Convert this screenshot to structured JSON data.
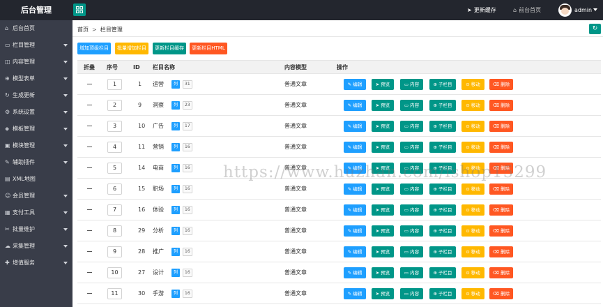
{
  "header": {
    "logo": "后台管理",
    "clear_cache": "更新缓存",
    "front_home": "前台首页",
    "admin": "admin"
  },
  "sidebar": {
    "items": [
      {
        "label": "后台首页",
        "icon": "home-icon",
        "caret": false
      },
      {
        "label": "栏目管理",
        "icon": "monitor-icon",
        "caret": true
      },
      {
        "label": "内容管理",
        "icon": "layers-icon",
        "caret": true
      },
      {
        "label": "模型表单",
        "icon": "globe-icon",
        "caret": true
      },
      {
        "label": "生成更新",
        "icon": "refresh-icon",
        "caret": true
      },
      {
        "label": "系统设置",
        "icon": "gear-icon",
        "caret": true
      },
      {
        "label": "模板管理",
        "icon": "template-icon",
        "caret": true
      },
      {
        "label": "模块管理",
        "icon": "module-icon",
        "caret": true
      },
      {
        "label": "辅助插件",
        "icon": "plugin-icon",
        "caret": true
      },
      {
        "label": "XML地图",
        "icon": "map-icon",
        "caret": false
      },
      {
        "label": "会员管理",
        "icon": "user-icon",
        "caret": true
      },
      {
        "label": "支付工具",
        "icon": "wallet-icon",
        "caret": true
      },
      {
        "label": "批量维护",
        "icon": "tool-icon",
        "caret": true
      },
      {
        "label": "采集管理",
        "icon": "cloud-icon",
        "caret": true
      },
      {
        "label": "增值服务",
        "icon": "service-icon",
        "caret": true
      }
    ]
  },
  "breadcrumb": {
    "home": "首页",
    "separator": ">",
    "current": "栏目管理"
  },
  "toolbar": {
    "add_top": "增加顶级栏目",
    "batch_add": "批量增加栏目",
    "update_cache": "更新栏目缓存",
    "update_html": "更新栏目HTML"
  },
  "table": {
    "headers": {
      "fold": "折叠",
      "sort": "序号",
      "id": "ID",
      "name": "栏目名称",
      "model": "内容模型",
      "ops": "操作"
    },
    "list_badge": "列",
    "ops": {
      "edit": "编辑",
      "preview": "预览",
      "content": "内容",
      "sub": "子栏目",
      "move": "移动",
      "delete": "删除"
    },
    "rows": [
      {
        "sort": "1",
        "id": "1",
        "name": "运营",
        "count": "31",
        "model": "普通文章"
      },
      {
        "sort": "2",
        "id": "9",
        "name": "洞察",
        "count": "23",
        "model": "普通文章"
      },
      {
        "sort": "3",
        "id": "10",
        "name": "广告",
        "count": "17",
        "model": "普通文章"
      },
      {
        "sort": "4",
        "id": "11",
        "name": "营销",
        "count": "16",
        "model": "普通文章"
      },
      {
        "sort": "5",
        "id": "14",
        "name": "电商",
        "count": "16",
        "model": "普通文章"
      },
      {
        "sort": "6",
        "id": "15",
        "name": "职场",
        "count": "16",
        "model": "普通文章"
      },
      {
        "sort": "7",
        "id": "16",
        "name": "体验",
        "count": "16",
        "model": "普通文章"
      },
      {
        "sort": "8",
        "id": "29",
        "name": "分析",
        "count": "16",
        "model": "普通文章"
      },
      {
        "sort": "9",
        "id": "28",
        "name": "推广",
        "count": "16",
        "model": "普通文章"
      },
      {
        "sort": "10",
        "id": "27",
        "name": "设计",
        "count": "16",
        "model": "普通文章"
      },
      {
        "sort": "11",
        "id": "30",
        "name": "手游",
        "count": "16",
        "model": "普通文章"
      }
    ]
  },
  "watermark": "https://www.huzhan.com/ishop15299",
  "colors": {
    "header_bg": "#23262e",
    "sidebar_bg": "#393d49",
    "primary_green": "#009688",
    "blue": "#1e9fff",
    "yellow": "#ffb800",
    "red": "#ff5722"
  }
}
